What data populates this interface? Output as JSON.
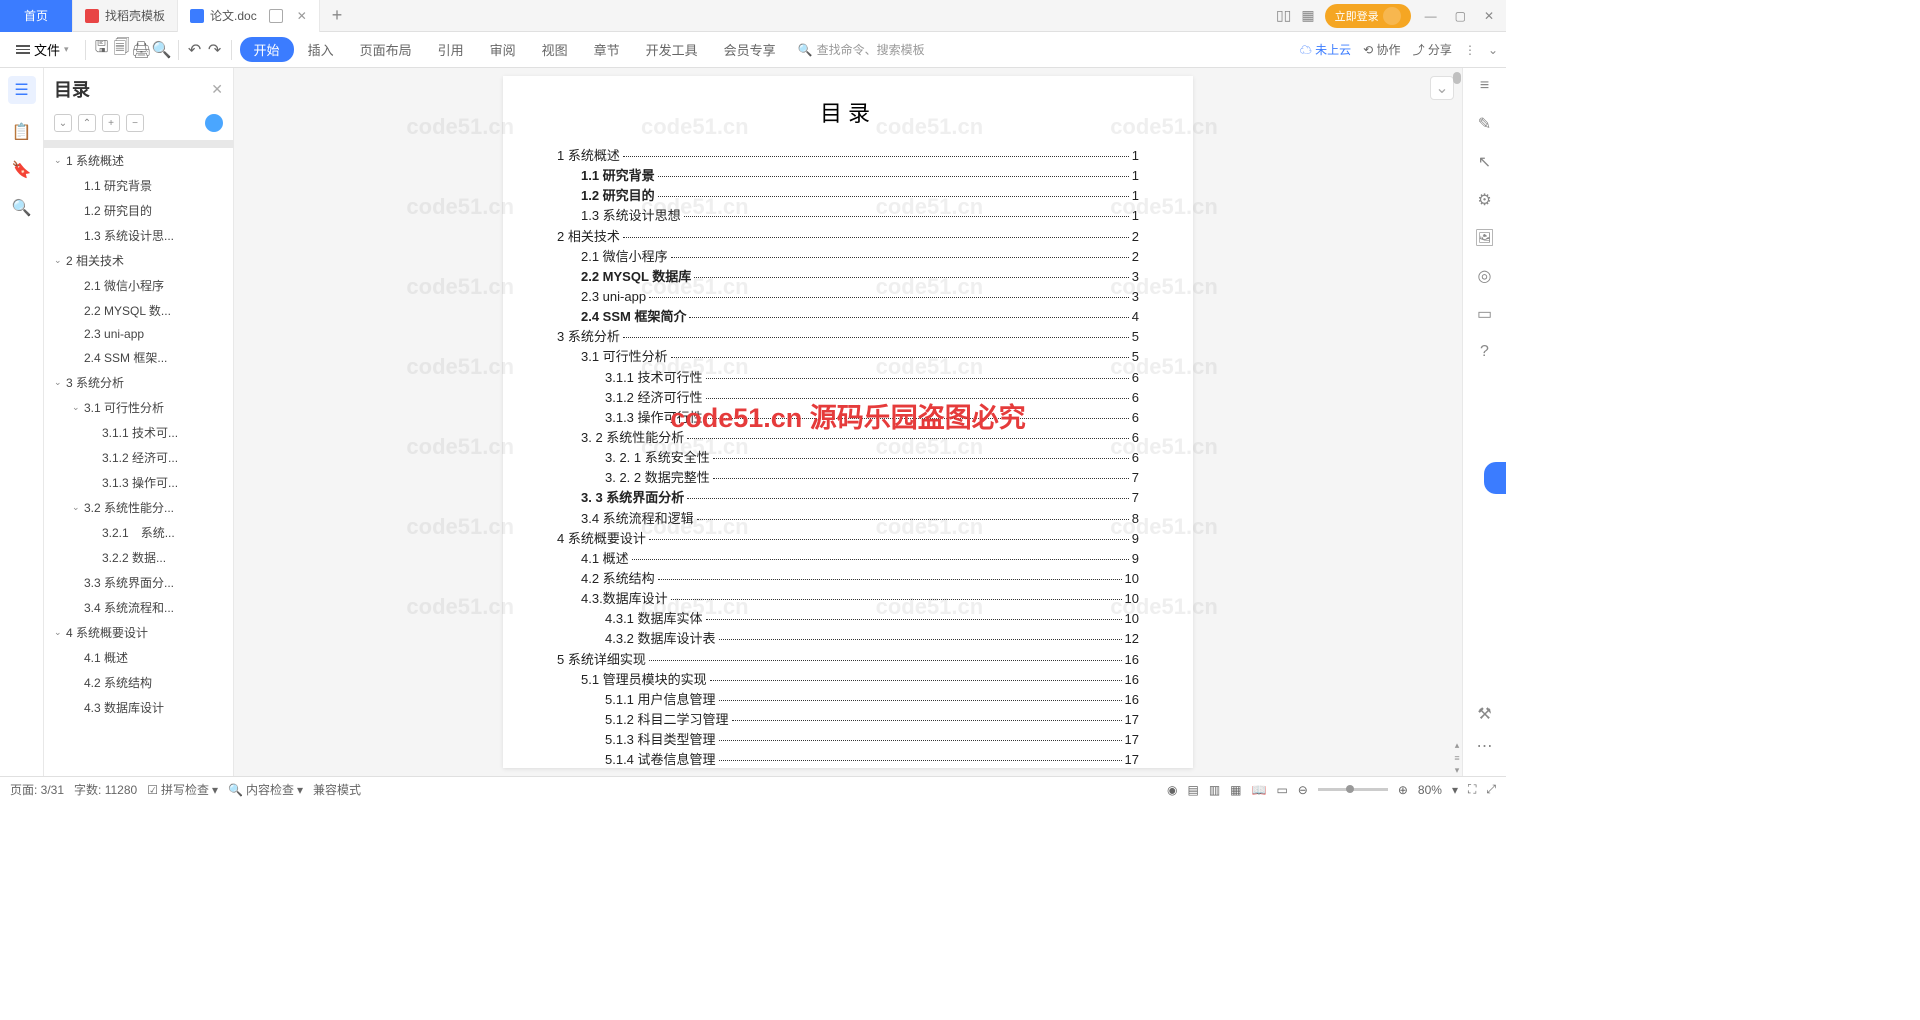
{
  "tabs": {
    "home": "首页",
    "t1": "找稻壳模板",
    "t2": "论文.doc",
    "login": "立即登录"
  },
  "menu": {
    "file": "文件",
    "items": [
      "开始",
      "插入",
      "页面布局",
      "引用",
      "审阅",
      "视图",
      "章节",
      "开发工具",
      "会员专享"
    ],
    "search_placeholder": "查找命令、搜索模板",
    "cloud": "未上云",
    "collab": "协作",
    "share": "分享"
  },
  "outline": {
    "title": "目录",
    "items": [
      {
        "lvl": 0,
        "selected": true,
        "label": "",
        "hasChev": false
      },
      {
        "lvl": 0,
        "label": "1 系统概述",
        "hasChev": true
      },
      {
        "lvl": 1,
        "label": "1.1 研究背景"
      },
      {
        "lvl": 1,
        "label": "1.2 研究目的"
      },
      {
        "lvl": 1,
        "label": "1.3 系统设计思..."
      },
      {
        "lvl": 0,
        "label": "2 相关技术",
        "hasChev": true
      },
      {
        "lvl": 1,
        "label": "2.1 微信小程序"
      },
      {
        "lvl": 1,
        "label": "2.2 MYSQL 数..."
      },
      {
        "lvl": 1,
        "label": "2.3 uni-app"
      },
      {
        "lvl": 1,
        "label": "2.4 SSM 框架..."
      },
      {
        "lvl": 0,
        "label": "3 系统分析",
        "hasChev": true
      },
      {
        "lvl": 1,
        "label": "3.1 可行性分析",
        "hasChev": true
      },
      {
        "lvl": 2,
        "label": "3.1.1 技术可..."
      },
      {
        "lvl": 2,
        "label": "3.1.2 经济可..."
      },
      {
        "lvl": 2,
        "label": "3.1.3 操作可..."
      },
      {
        "lvl": 1,
        "label": "3.2 系统性能分...",
        "hasChev": true
      },
      {
        "lvl": 2,
        "label": "3.2.1　系统..."
      },
      {
        "lvl": 2,
        "label": "3.2.2 数据..."
      },
      {
        "lvl": 1,
        "label": "3.3 系统界面分..."
      },
      {
        "lvl": 1,
        "label": "3.4 系统流程和..."
      },
      {
        "lvl": 0,
        "label": "4 系统概要设计",
        "hasChev": true
      },
      {
        "lvl": 1,
        "label": "4.1 概述"
      },
      {
        "lvl": 1,
        "label": "4.2 系统结构"
      },
      {
        "lvl": 1,
        "label": "4.3 数据库设计"
      }
    ]
  },
  "doc": {
    "title": "目录",
    "wm_main": "code51.cn 源码乐园盗图必究",
    "wm_bg": "code51.cn",
    "toc": [
      {
        "ind": 0,
        "text": "1 系统概述",
        "pg": "1"
      },
      {
        "ind": 1,
        "text": "1.1 研究背景",
        "pg": "1",
        "bold": true
      },
      {
        "ind": 1,
        "text": "1.2 研究目的",
        "pg": "1",
        "bold": true
      },
      {
        "ind": 1,
        "text": "1.3 系统设计思想",
        "pg": "1"
      },
      {
        "ind": 0,
        "text": "2 相关技术",
        "pg": "2"
      },
      {
        "ind": 1,
        "text": "2.1 微信小程序",
        "pg": "2"
      },
      {
        "ind": 1,
        "text": "2.2 MYSQL 数据库",
        "pg": "3",
        "bold": true
      },
      {
        "ind": 1,
        "text": "2.3 uni-app",
        "pg": "3"
      },
      {
        "ind": 1,
        "text": "2.4 SSM 框架简介",
        "pg": "4",
        "bold": true
      },
      {
        "ind": 0,
        "text": "3 系统分析",
        "pg": "5"
      },
      {
        "ind": 1,
        "text": "3.1 可行性分析",
        "pg": "5"
      },
      {
        "ind": 2,
        "text": "3.1.1 技术可行性",
        "pg": "6"
      },
      {
        "ind": 2,
        "text": "3.1.2 经济可行性",
        "pg": "6"
      },
      {
        "ind": 2,
        "text": "3.1.3 操作可行性",
        "pg": "6"
      },
      {
        "ind": 1,
        "text": "3. 2 系统性能分析",
        "pg": "6"
      },
      {
        "ind": 2,
        "text": "3. 2. 1  系统安全性",
        "pg": "6"
      },
      {
        "ind": 2,
        "text": "3. 2. 2  数据完整性",
        "pg": "7"
      },
      {
        "ind": 1,
        "text": "3. 3 系统界面分析",
        "pg": "7",
        "bold": true
      },
      {
        "ind": 1,
        "text": "3.4 系统流程和逻辑",
        "pg": "8"
      },
      {
        "ind": 0,
        "text": "4 系统概要设计",
        "pg": "9"
      },
      {
        "ind": 1,
        "text": "4.1 概述",
        "pg": "9"
      },
      {
        "ind": 1,
        "text": "4.2 系统结构",
        "pg": "10"
      },
      {
        "ind": 1,
        "text": "4.3.数据库设计",
        "pg": "10"
      },
      {
        "ind": 2,
        "text": "4.3.1 数据库实体",
        "pg": "10"
      },
      {
        "ind": 2,
        "text": "4.3.2 数据库设计表",
        "pg": "12"
      },
      {
        "ind": 0,
        "text": "5 系统详细实现",
        "pg": "16"
      },
      {
        "ind": 1,
        "text": "5.1 管理员模块的实现",
        "pg": "16"
      },
      {
        "ind": 2,
        "text": "5.1.1 用户信息管理",
        "pg": "16"
      },
      {
        "ind": 2,
        "text": "5.1.2 科目二学习管理",
        "pg": "17"
      },
      {
        "ind": 2,
        "text": "5.1.3 科目类型管理",
        "pg": "17"
      },
      {
        "ind": 2,
        "text": "5.1.4 试卷信息管理",
        "pg": "17"
      }
    ]
  },
  "status": {
    "page": "页面: 3/31",
    "words": "字数: 11280",
    "spell": "拼写检查",
    "content": "内容检查",
    "compat": "兼容模式",
    "zoom": "80%"
  }
}
